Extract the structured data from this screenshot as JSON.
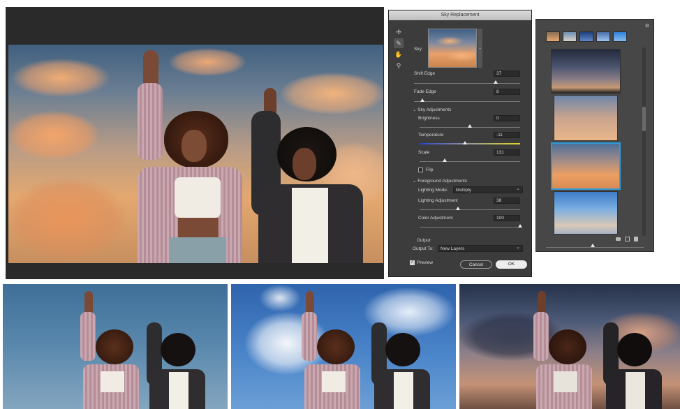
{
  "dialog": {
    "title": "Sky Replacement",
    "sky_label": "Sky:",
    "shift_edge": {
      "label": "Shift Edge",
      "value": "37",
      "level": 0.77
    },
    "fade_edge": {
      "label": "Fade Edge",
      "value": "8",
      "level": 0.08
    },
    "sky_adjustments": {
      "label": "Sky Adjustments",
      "brightness": {
        "label": "Brightness",
        "value": "0",
        "level": 0.5
      },
      "temperature": {
        "label": "Temperature",
        "value": "-11",
        "level": 0.45
      },
      "scale": {
        "label": "Scale",
        "value": "131",
        "level": 0.25
      },
      "flip_label": "Flip"
    },
    "foreground_adjustments": {
      "label": "Foreground Adjustments",
      "lighting_mode_label": "Lighting Mode:",
      "lighting_mode_value": "Multiply",
      "lighting_adjustment": {
        "label": "Lighting Adjustment",
        "value": "38",
        "level": 0.38
      },
      "color_adjustment": {
        "label": "Color Adjustment",
        "value": "100",
        "level": 1.0
      }
    },
    "output": {
      "label": "Output",
      "output_to_label": "Output To:",
      "output_to_value": "New Layers"
    },
    "preview_label": "Preview",
    "cancel_label": "Cancel",
    "ok_label": "OK",
    "tools": [
      "move-icon",
      "sky-brush-icon",
      "hand-icon",
      "zoom-icon"
    ]
  },
  "presets": {
    "menu_icon": "gear-icon",
    "footer_icons": [
      "folder-icon",
      "new-preset-icon",
      "trash-icon"
    ]
  },
  "colors": {
    "dialog_bg": "#3c3c3c",
    "accent_selection": "#2f9bd6",
    "ok_button": "#ededed"
  }
}
